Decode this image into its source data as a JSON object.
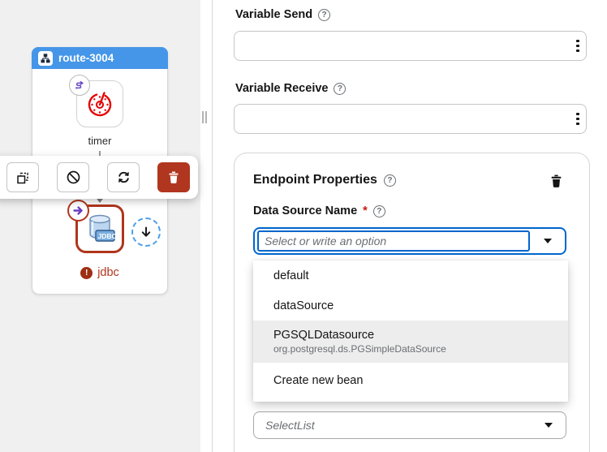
{
  "canvas": {
    "route_title": "route-3004",
    "timer_label": "timer",
    "jdbc_label": "jdbc"
  },
  "fields": {
    "variable_send": {
      "label": "Variable Send",
      "value": ""
    },
    "variable_receive": {
      "label": "Variable Receive",
      "value": ""
    }
  },
  "endpoint": {
    "title": "Endpoint Properties",
    "data_source": {
      "label": "Data Source Name",
      "required": "*",
      "placeholder": "Select or write an option"
    },
    "options": [
      {
        "label": "default"
      },
      {
        "label": "dataSource"
      },
      {
        "label": "PGSQLDatasource",
        "description": "org.postgresql.ds.PGSimpleDataSource"
      },
      {
        "label": "Create new bean"
      }
    ],
    "select_list": {
      "placeholder": "SelectList"
    }
  },
  "colors": {
    "route_header_blue": "#4596e8",
    "danger_rust": "#b1361f",
    "focus_blue": "#0066cc",
    "accent_violet": "#6a4bc4",
    "canvas_bg": "#f0f0f0",
    "option_highlight": "#ededed"
  }
}
